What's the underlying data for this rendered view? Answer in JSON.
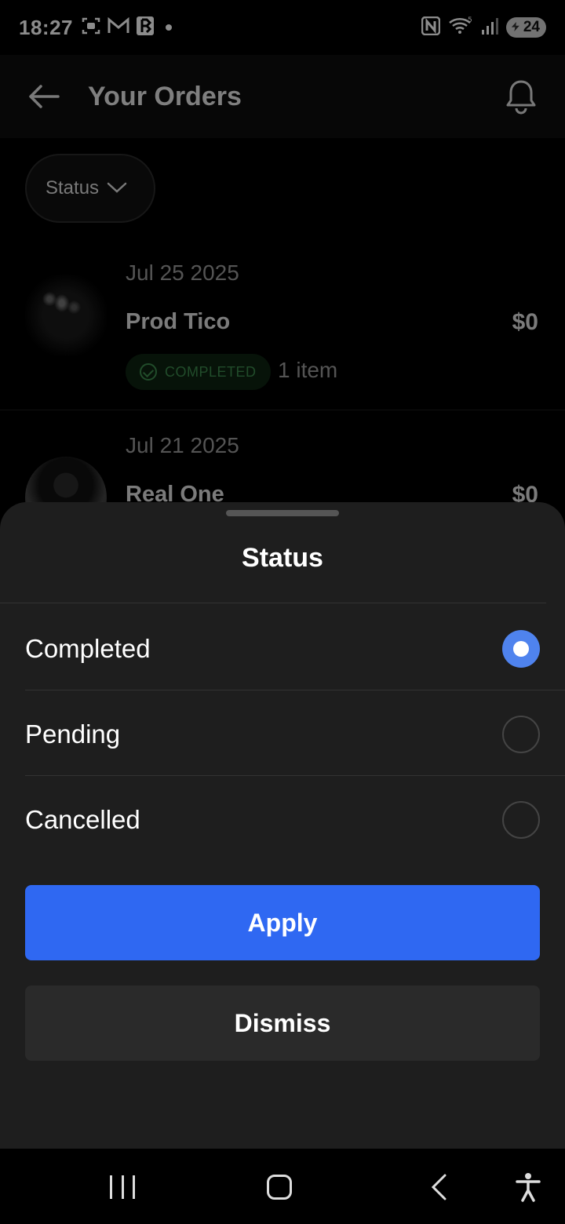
{
  "status_bar": {
    "time": "18:27",
    "battery": "24",
    "left_icons": [
      "screenshot-icon",
      "gmail-icon",
      "app-icon"
    ],
    "right_icons": [
      "nfc-icon",
      "wifi-icon",
      "signal-icon",
      "battery-icon"
    ]
  },
  "header": {
    "title": "Your Orders"
  },
  "filter_chip": {
    "label": "Status"
  },
  "orders": [
    {
      "date": "Jul 25 2025",
      "name": "Prod Tico",
      "price": "$0",
      "status": "COMPLETED",
      "items": "1 item"
    },
    {
      "date": "Jul 21 2025",
      "name": "Real One",
      "price": "$0"
    }
  ],
  "sheet": {
    "title": "Status",
    "options": [
      {
        "label": "Completed",
        "selected": true
      },
      {
        "label": "Pending",
        "selected": false
      },
      {
        "label": "Cancelled",
        "selected": false
      }
    ],
    "apply_label": "Apply",
    "dismiss_label": "Dismiss"
  },
  "colors": {
    "accent": "#2f68f2",
    "radio_selected": "#4f83ee",
    "sheet_bg": "#1e1e1e",
    "completed_green": "#3d8a4d"
  }
}
